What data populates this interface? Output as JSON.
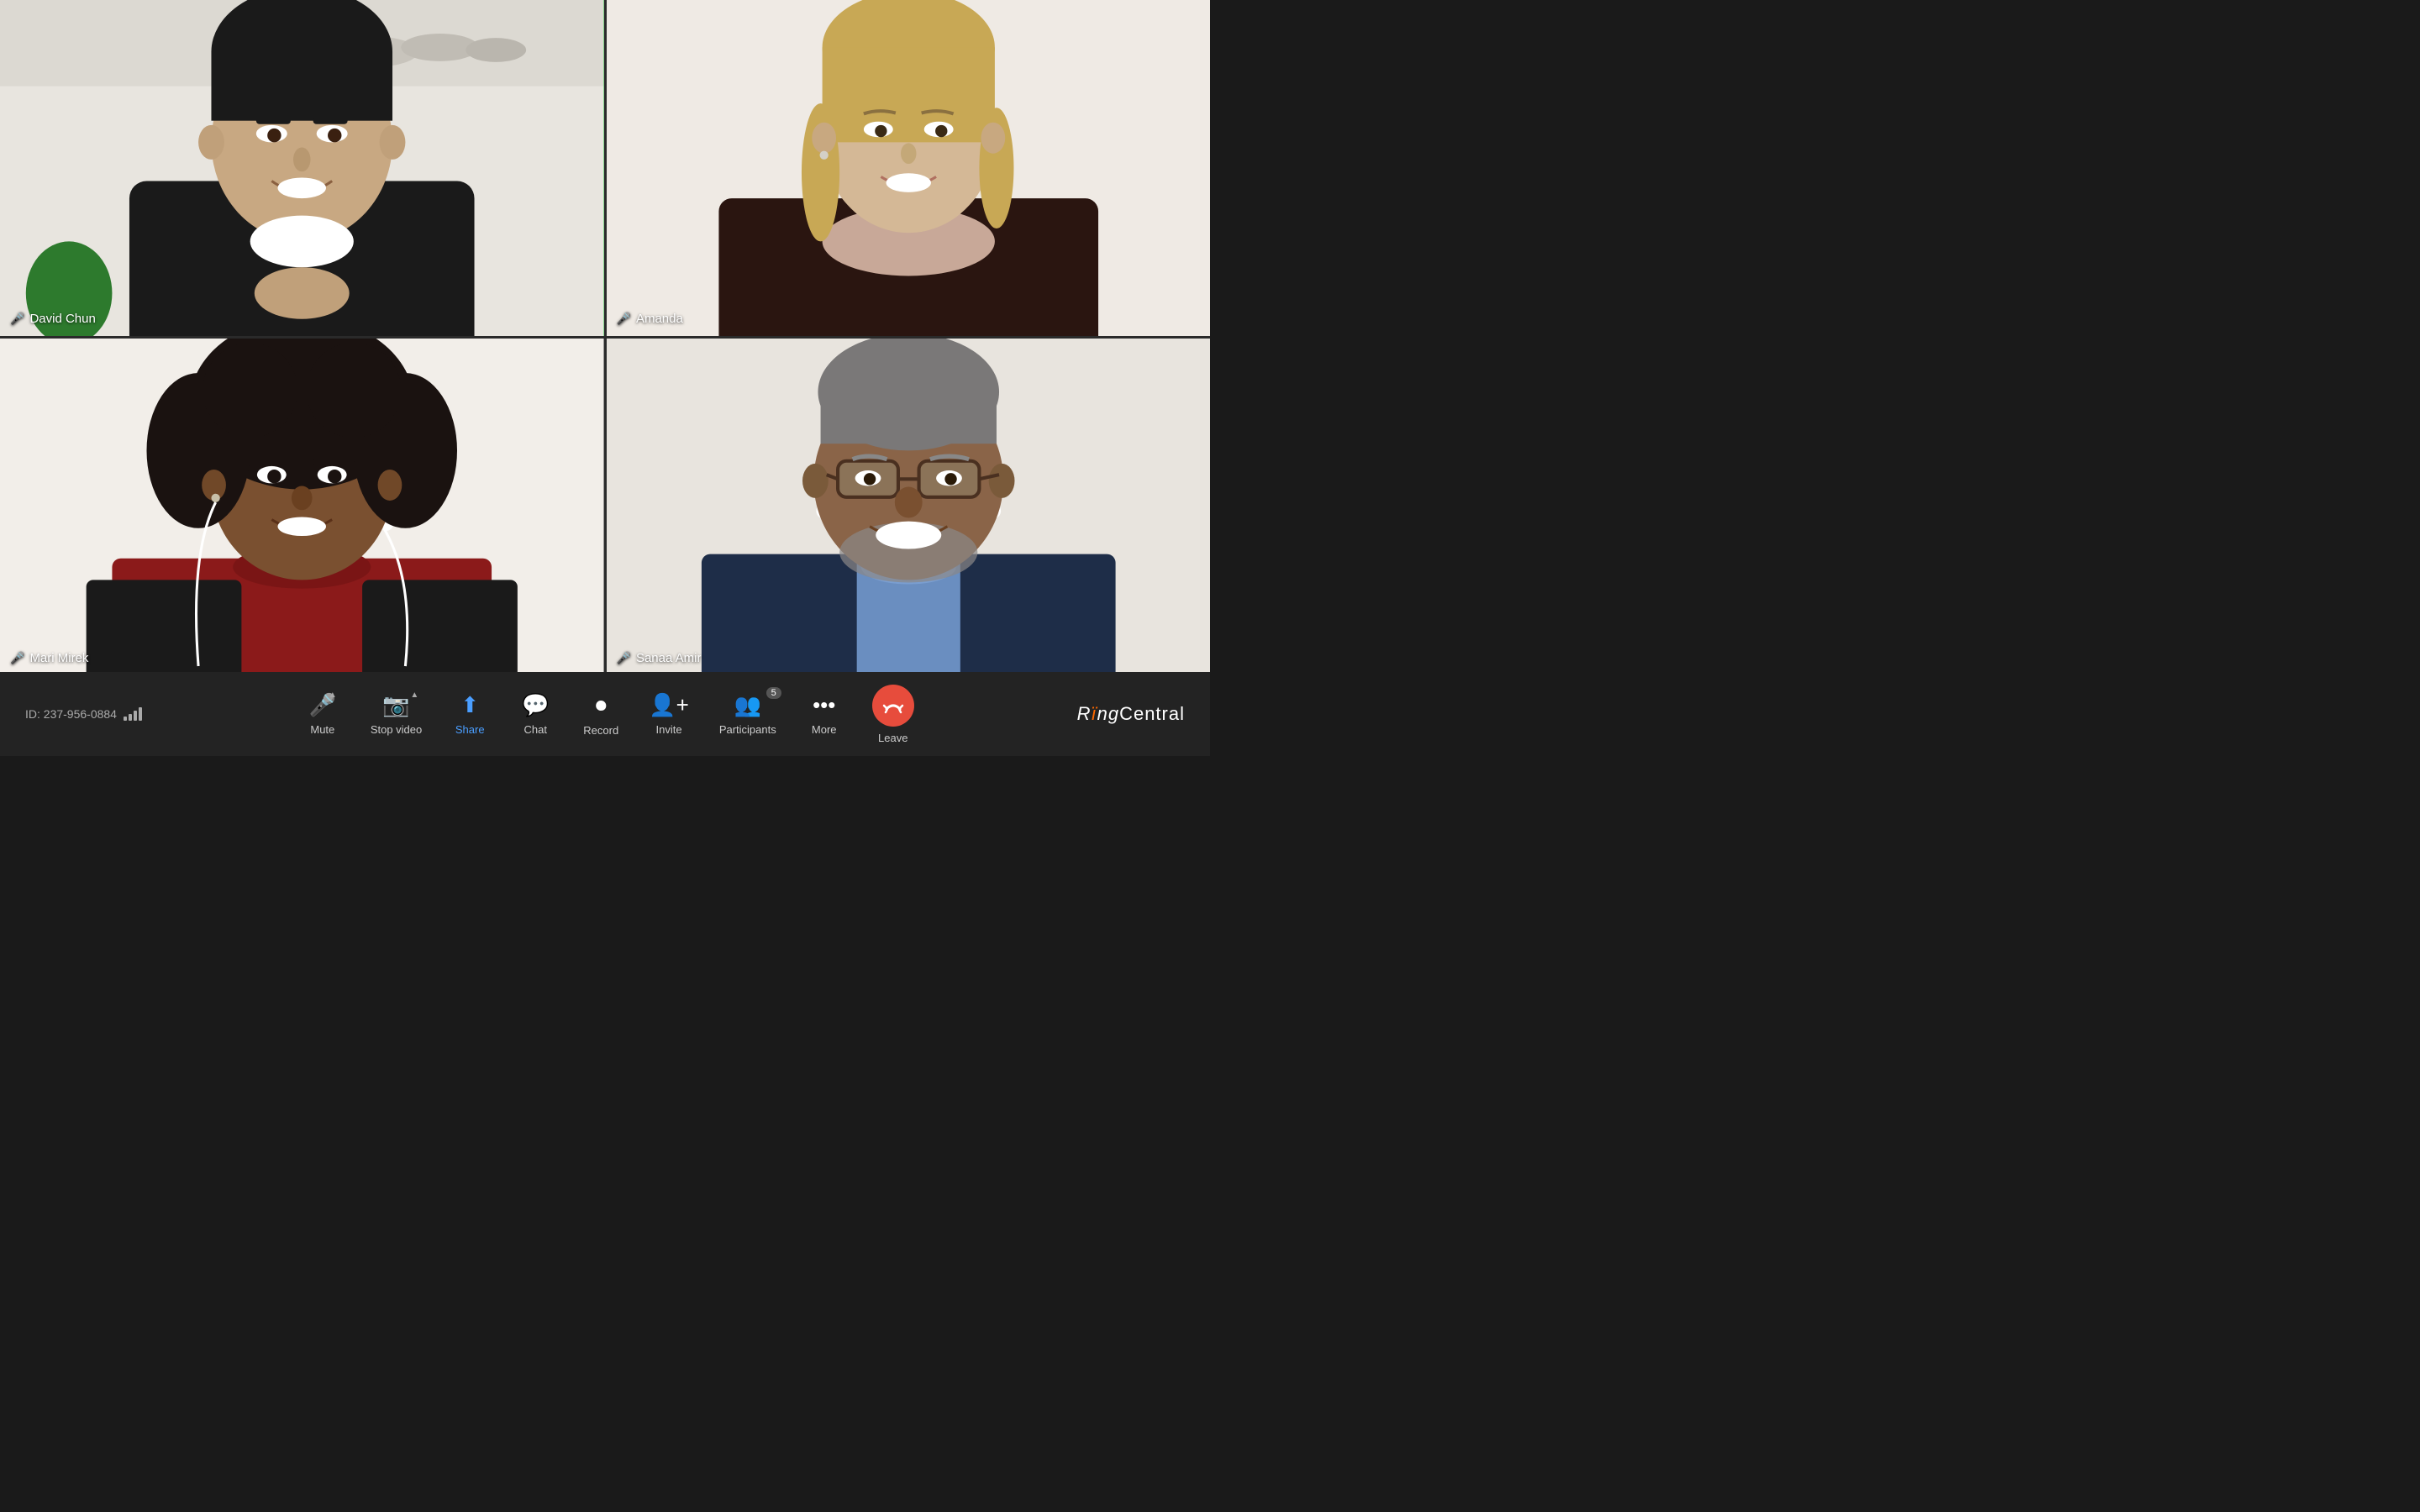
{
  "app": {
    "brand": "RïngCentral",
    "brand_pre": "Rïng",
    "brand_post": "Central"
  },
  "meeting": {
    "id_label": "ID: 237-956-0884"
  },
  "participants": [
    {
      "id": "david-chun",
      "name": "David Chun",
      "mic_active": true,
      "active_speaker": true,
      "position": "top-left"
    },
    {
      "id": "amanda",
      "name": "Amanda",
      "mic_active": false,
      "mic_muted": true,
      "active_speaker": false,
      "position": "top-right"
    },
    {
      "id": "mari-mirek",
      "name": "Mari Mirek",
      "mic_active": true,
      "active_speaker": false,
      "position": "bottom-left"
    },
    {
      "id": "sanaa-amir",
      "name": "Sanaa Amir",
      "mic_active": true,
      "active_speaker": false,
      "position": "bottom-right"
    }
  ],
  "toolbar": {
    "meeting_id": "ID: 237-956-0884",
    "buttons": [
      {
        "id": "mute",
        "label": "Mute",
        "has_chevron": true
      },
      {
        "id": "stop-video",
        "label": "Stop video",
        "has_chevron": true
      },
      {
        "id": "share",
        "label": "Share",
        "has_chevron": false,
        "highlight": true
      },
      {
        "id": "chat",
        "label": "Chat",
        "has_chevron": false
      },
      {
        "id": "record",
        "label": "Record",
        "has_chevron": false
      },
      {
        "id": "invite",
        "label": "Invite",
        "has_chevron": false
      },
      {
        "id": "participants",
        "label": "Participants",
        "has_chevron": false,
        "badge": "5"
      },
      {
        "id": "more",
        "label": "More",
        "has_chevron": false
      },
      {
        "id": "leave",
        "label": "Leave",
        "has_chevron": false,
        "is_leave": true
      }
    ]
  }
}
